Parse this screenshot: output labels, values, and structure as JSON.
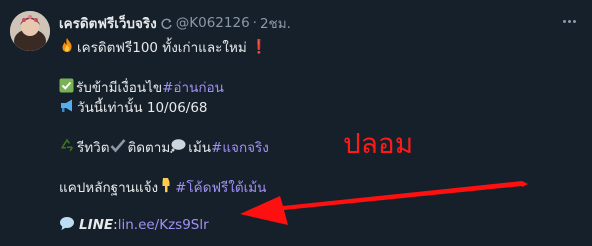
{
  "author": {
    "display_name": "เครดิตฟรีเว็บจริง",
    "handle": "@K062126",
    "separator": "·",
    "timestamp": "2ชม."
  },
  "tweet": {
    "line1_text": "เครดิตฟรี100  ทั้งเก่าและใหม่",
    "line1_mark": "❗",
    "line2_text": "รับข้ามีเงื่อนไข ",
    "line2_hashtag": "#อ่านก่อน",
    "line3_text": "วันนี้เท่านั้น 10/06/68",
    "line4_retweet": "รีทวิต ",
    "line4_follow": " ติดตาม ",
    "line4_comment": "เม้น ",
    "line4_hashtag": "#แจกจริง",
    "line5_text": "แคปหลักฐานแจ้ง",
    "line5_hashtag": "#โค้ดฟรีใต้เม้น",
    "line6_brand": "LINE",
    "line6_colon": " :",
    "line6_link": "lin.ee/Kzs9Slr"
  },
  "annotation": {
    "label": "ปลอม"
  },
  "icons": {
    "avatar": "avatar-image",
    "more": "more-icon",
    "sync": "sync-icon",
    "fire": "fire-emoji",
    "check": "check-box-emoji",
    "megaphone": "megaphone-emoji",
    "recycle": "recycle-emoji",
    "checkmark": "checkmark-emoji",
    "speech": "speech-bubble-emoji",
    "pointing_down": "pointing-down-emoji",
    "speech_balloon": "speech-balloon-emoji",
    "arrow": "red-arrow"
  },
  "colors": {
    "background": "#16202a",
    "text": "#e7e9ea",
    "muted": "#8b98a5",
    "link": "#a390f5",
    "annotation": "#ff1a1a"
  }
}
